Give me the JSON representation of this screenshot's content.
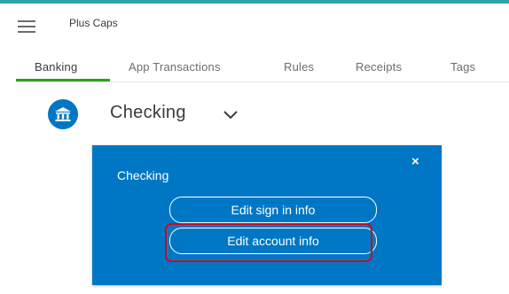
{
  "header": {
    "menu_icon": "hamburger-menu-icon",
    "company_name": "Plus Caps"
  },
  "tabs": [
    {
      "label": "Banking",
      "active": true
    },
    {
      "label": "App Transactions",
      "active": false
    },
    {
      "label": "Rules",
      "active": false
    },
    {
      "label": "Receipts",
      "active": false
    },
    {
      "label": "Tags",
      "active": false
    }
  ],
  "account": {
    "icon": "bank-icon",
    "name": "Checking",
    "dropdown_icon": "chevron-down-icon"
  },
  "popover": {
    "title": "Checking",
    "close_label": "×",
    "edit_sign_in_label": "Edit sign in info",
    "edit_account_label": "Edit account info"
  },
  "colors": {
    "accent_top": "#2ca6a4",
    "tab_active_underline": "#2ca01c",
    "popover_bg": "#0077c5",
    "highlight": "#d1091b"
  }
}
